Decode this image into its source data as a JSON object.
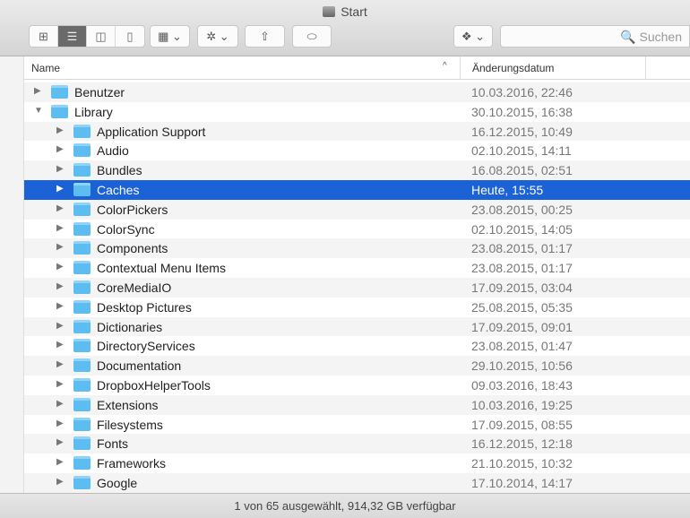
{
  "window": {
    "title": "Start"
  },
  "toolbar": {
    "view_icons": "⊞",
    "view_list": "☰",
    "view_columns": "◫",
    "view_coverflow": "▯",
    "arrange": "▦ ⌄",
    "action": "✲ ⌄",
    "share": "⇧",
    "tags": "⬭",
    "dropbox": "❖ ⌄",
    "search_placeholder": "🔍 Suchen"
  },
  "header": {
    "name": "Name",
    "sort": "^",
    "date": "Änderungsdatum"
  },
  "rows": [
    {
      "name": "Benutzer",
      "date": "10.03.2016, 22:46",
      "level": 0,
      "expanded": false
    },
    {
      "name": "Library",
      "date": "30.10.2015, 16:38",
      "level": 0,
      "expanded": true
    },
    {
      "name": "Application Support",
      "date": "16.12.2015, 10:49",
      "level": 1
    },
    {
      "name": "Audio",
      "date": "02.10.2015, 14:11",
      "level": 1
    },
    {
      "name": "Bundles",
      "date": "16.08.2015, 02:51",
      "level": 1
    },
    {
      "name": "Caches",
      "date": "Heute, 15:55",
      "level": 1,
      "selected": true
    },
    {
      "name": "ColorPickers",
      "date": "23.08.2015, 00:25",
      "level": 1
    },
    {
      "name": "ColorSync",
      "date": "02.10.2015, 14:05",
      "level": 1
    },
    {
      "name": "Components",
      "date": "23.08.2015, 01:17",
      "level": 1
    },
    {
      "name": "Contextual Menu Items",
      "date": "23.08.2015, 01:17",
      "level": 1
    },
    {
      "name": "CoreMediaIO",
      "date": "17.09.2015, 03:04",
      "level": 1
    },
    {
      "name": "Desktop Pictures",
      "date": "25.08.2015, 05:35",
      "level": 1
    },
    {
      "name": "Dictionaries",
      "date": "17.09.2015, 09:01",
      "level": 1
    },
    {
      "name": "DirectoryServices",
      "date": "23.08.2015, 01:47",
      "level": 1
    },
    {
      "name": "Documentation",
      "date": "29.10.2015, 10:56",
      "level": 1
    },
    {
      "name": "DropboxHelperTools",
      "date": "09.03.2016, 18:43",
      "level": 1
    },
    {
      "name": "Extensions",
      "date": "10.03.2016, 19:25",
      "level": 1
    },
    {
      "name": "Filesystems",
      "date": "17.09.2015, 08:55",
      "level": 1
    },
    {
      "name": "Fonts",
      "date": "16.12.2015, 12:18",
      "level": 1
    },
    {
      "name": "Frameworks",
      "date": "21.10.2015, 10:32",
      "level": 1
    },
    {
      "name": "Google",
      "date": "17.10.2014, 14:17",
      "level": 1
    }
  ],
  "status": "1 von 65 ausgewählt, 914,32 GB verfügbar"
}
